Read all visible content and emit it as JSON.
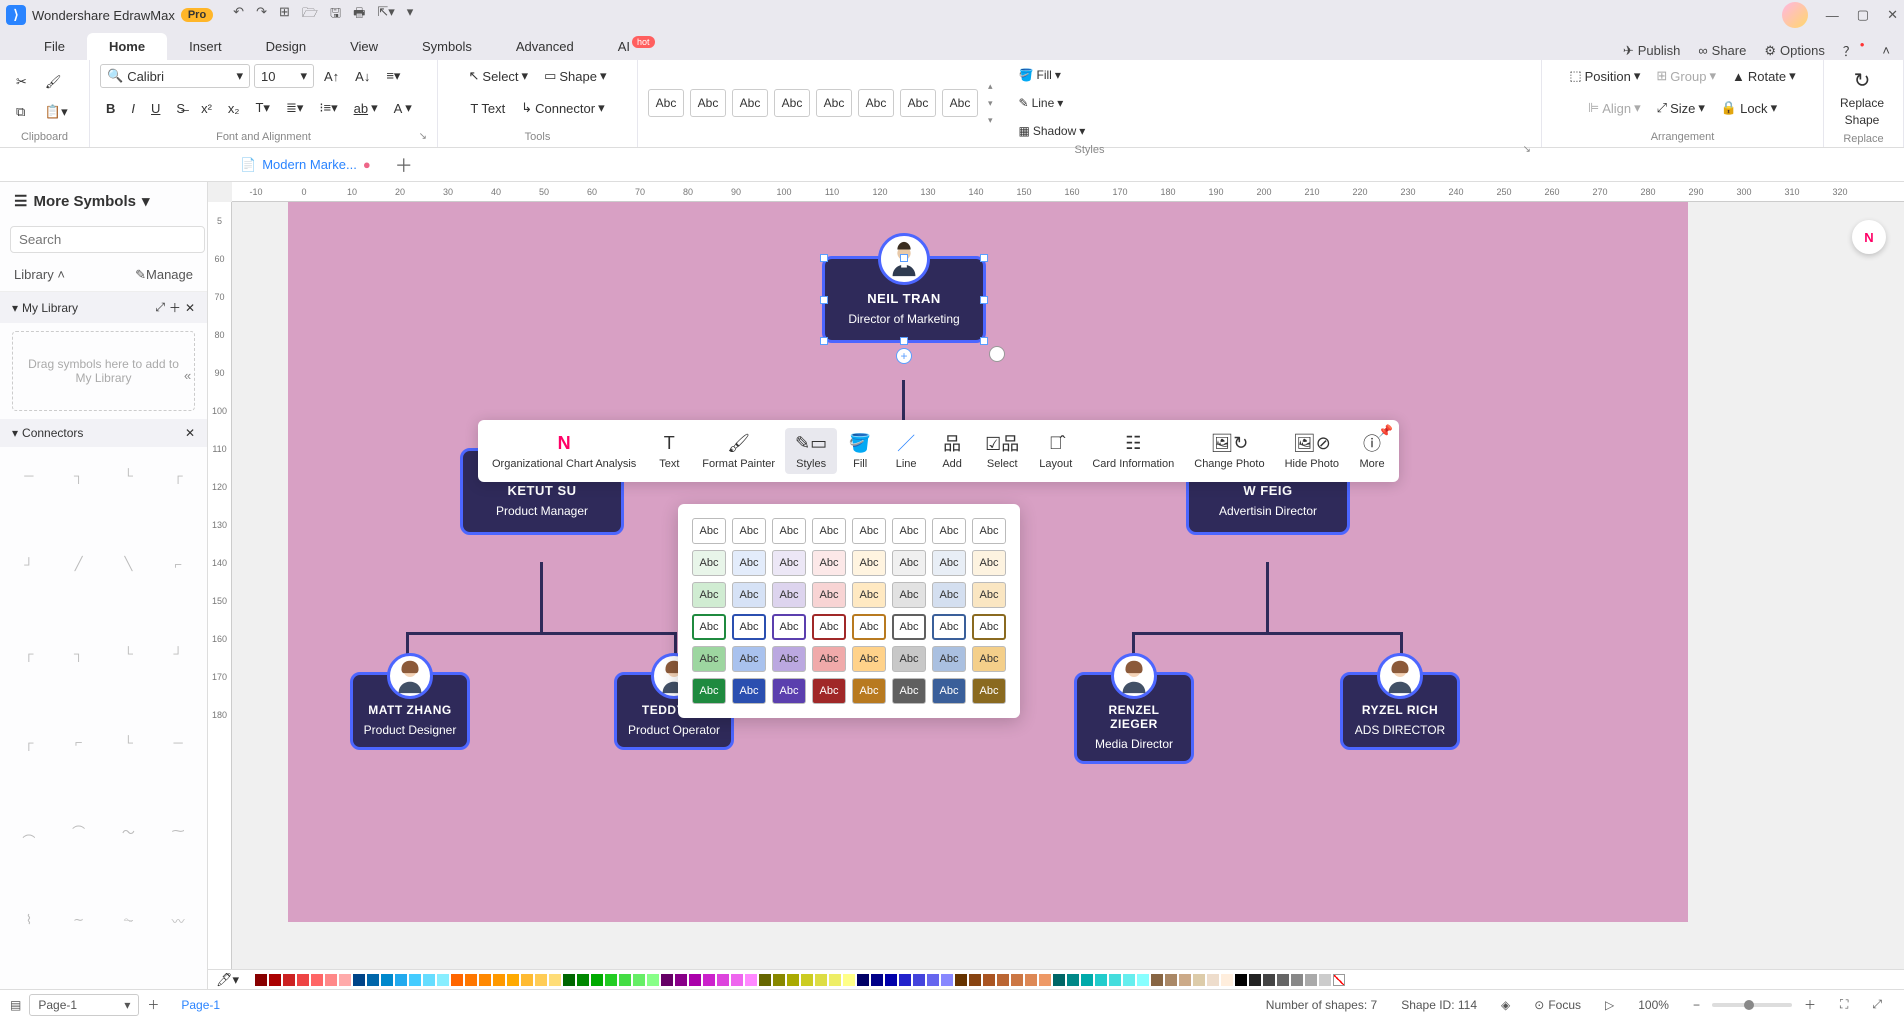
{
  "titlebar": {
    "app": "Wondershare EdrawMax",
    "pro": "Pro"
  },
  "menu": {
    "file": "File",
    "home": "Home",
    "insert": "Insert",
    "design": "Design",
    "view": "View",
    "symbols": "Symbols",
    "advanced": "Advanced",
    "ai": "AI",
    "hot": "hot",
    "publish": "Publish",
    "share": "Share",
    "options": "Options"
  },
  "ribbon": {
    "clipboard": "Clipboard",
    "font_family": "Calibri",
    "font_size": "10",
    "font_align": "Font and Alignment",
    "select": "Select",
    "text": "Text",
    "shape": "Shape",
    "connector": "Connector",
    "tools": "Tools",
    "fill": "Fill",
    "line": "Line",
    "shadow": "Shadow",
    "styles": "Styles",
    "abc": "Abc",
    "position": "Position",
    "group": "Group",
    "rotate": "Rotate",
    "align": "Align",
    "size": "Size",
    "lock": "Lock",
    "arrangement": "Arrangement",
    "replace_top": "Replace",
    "replace_bot": "Shape",
    "replace": "Replace"
  },
  "doctab": "Modern Marke...",
  "left": {
    "title": "More Symbols",
    "search_ph": "Search",
    "search_btn": "Search",
    "library": "Library",
    "manage": "Manage",
    "mylib": "My Library",
    "drop": "Drag symbols here to add to My Library",
    "connectors": "Connectors"
  },
  "ruler_h": [
    "-10",
    "0",
    "10",
    "20",
    "30",
    "40",
    "50",
    "60",
    "70",
    "80",
    "90",
    "100",
    "110",
    "120",
    "130",
    "140",
    "150",
    "160",
    "170",
    "180",
    "190",
    "200",
    "210",
    "220",
    "230",
    "240",
    "250",
    "260",
    "270",
    "280",
    "290",
    "300",
    "310",
    "320"
  ],
  "ruler_v": [
    "5",
    "60",
    "70",
    "80",
    "90",
    "100",
    "110",
    "120",
    "130",
    "140",
    "150",
    "160",
    "170",
    "180"
  ],
  "org": {
    "n1": {
      "name": "NEIL TRAN",
      "role": "Director of Marketing"
    },
    "n2": {
      "name": "KETUT SU",
      "role": "Product Manager"
    },
    "n3": {
      "name": "W FEIG",
      "role": "Advertisin Director"
    },
    "n4": {
      "name": "MATT ZHANG",
      "role": "Product Designer"
    },
    "n5": {
      "name": "TEDDY YU",
      "role": "Product Operator"
    },
    "n6": {
      "name": "RENZEL ZIEGER",
      "role": "Media Director"
    },
    "n7": {
      "name": "RYZEL RICH",
      "role": "ADS DIRECTOR"
    }
  },
  "float": {
    "oca": "Organizational Chart Analysis",
    "text": "Text",
    "fp": "Format Painter",
    "styles": "Styles",
    "fill": "Fill",
    "line": "Line",
    "add": "Add",
    "select": "Select",
    "layout": "Layout",
    "ci": "Card Information",
    "cp": "Change Photo",
    "hp": "Hide Photo",
    "more": "More"
  },
  "abc": "Abc",
  "status": {
    "page_sel": "Page-1",
    "page_link": "Page-1",
    "shapes": "Number of shapes: 7",
    "shapeid": "Shape ID: 114",
    "focus": "Focus",
    "zoom": "100%"
  }
}
